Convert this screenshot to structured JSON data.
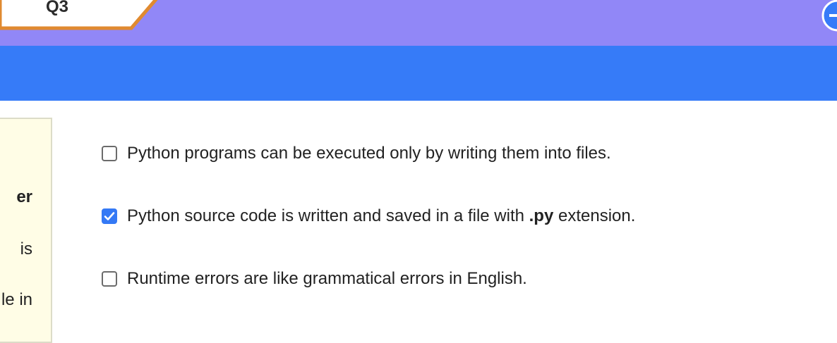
{
  "tab": {
    "label": "Q3"
  },
  "header": {
    "add_button_icon": "plus-circle-icon"
  },
  "colors": {
    "top_band": "#9187f7",
    "blue_bar": "#367bf8",
    "tab_border": "#e08a30",
    "checkbox_checked": "#3479f5",
    "side_panel": "#fffde6"
  },
  "side_panel": {
    "lines": [
      "er",
      "is",
      "le in"
    ]
  },
  "options": [
    {
      "text": "Python programs can be executed only by writing them into files.",
      "checked": false
    },
    {
      "text_before": "Python source code is written and saved in a file with ",
      "text_bold": ".py",
      "text_after": " extension.",
      "checked": true
    },
    {
      "text": "Runtime errors are like grammatical errors in English.",
      "checked": false
    }
  ]
}
